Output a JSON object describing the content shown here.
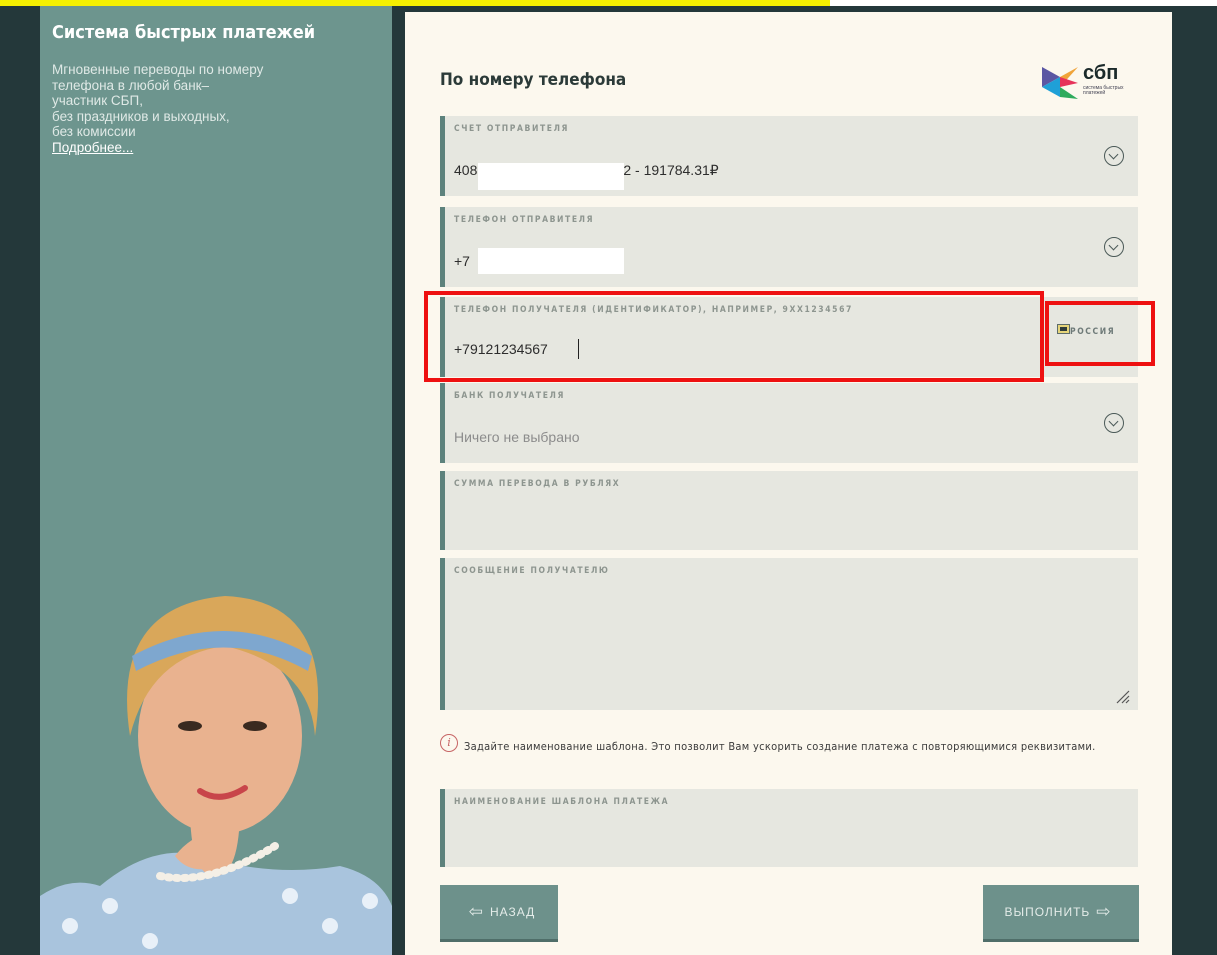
{
  "sidebar": {
    "title": "Система быстрых платежей",
    "description_lines": [
      "Мгновенные переводы по номеру",
      "телефона в любой банк–",
      "участник СБП,",
      "без праздников и выходных,",
      "без комиссии"
    ],
    "more_link": "Подробнее..."
  },
  "form": {
    "title": "По номеру телефона",
    "logo_text": "сбп",
    "logo_sub": "система быстрых платежей",
    "sender_account": {
      "label": "СЧЕТ ОТПРАВИТЕЛЯ",
      "value_prefix": "408",
      "value_suffix": "2 - 191784.31₽"
    },
    "sender_phone": {
      "label": "ТЕЛЕФОН ОТПРАВИТЕЛЯ",
      "value_prefix": "+7"
    },
    "recipient_phone": {
      "label": "ТЕЛЕФОН ПОЛУЧАТЕЛЯ (ИДЕНТИФИКАТОР), НАПРИМЕР, 9XX1234567",
      "value": "+79121234567",
      "country": "РОССИЯ"
    },
    "recipient_bank": {
      "label": "БАНК ПОЛУЧАТЕЛЯ",
      "placeholder": "Ничего не выбрано"
    },
    "amount": {
      "label": "СУММА ПЕРЕВОДА В РУБЛЯХ"
    },
    "message": {
      "label": "СООБЩЕНИЕ ПОЛУЧАТЕЛЮ"
    },
    "hint": "Задайте наименование шаблона. Это позволит Вам ускорить создание платежа с повторяющимися реквизитами.",
    "template_name": {
      "label": "НАИМЕНОВАНИЕ ШАБЛОНА ПЛАТЕЖА"
    },
    "back_button": "НАЗАД",
    "submit_button": "ВЫПОЛНИТЬ"
  },
  "colors": {
    "sidebar_bg": "#6d958e",
    "frame_bg": "#24383a",
    "card_bg": "#fcf8ee",
    "field_bg": "#e6e7e0",
    "accent": "#5d827c",
    "highlight": "#ee1111"
  },
  "icons": {
    "dropdown": "chevron-down-circle-icon",
    "back": "arrow-left-icon",
    "submit": "arrow-right-icon",
    "info": "info-icon",
    "resize": "resize-handle-icon",
    "flag": "flag-icon"
  }
}
